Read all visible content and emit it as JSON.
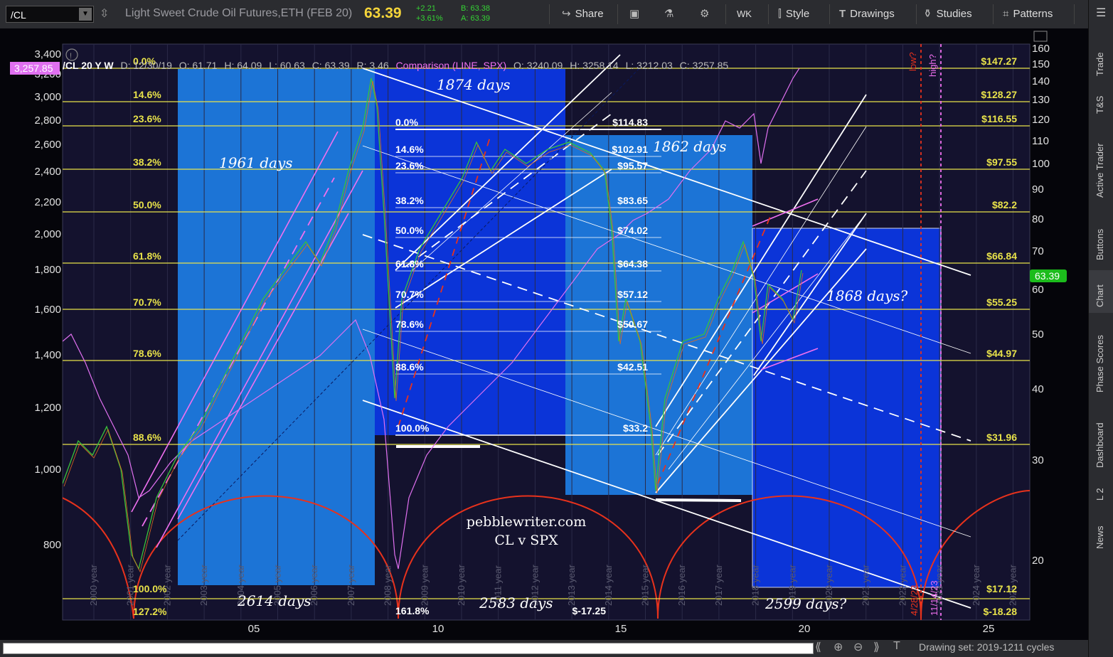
{
  "toolbar": {
    "symbol": "/CL",
    "instrument": "Light Sweet Crude Oil Futures,ETH (FEB 20)",
    "last": "63.39",
    "change": "+2.21",
    "change_pct": "+3.61%",
    "bid": "B: 63.38",
    "ask": "A: 63.39",
    "share": "Share",
    "wk": "WK",
    "style": "Style",
    "drawings": "Drawings",
    "studies": "Studies",
    "patterns": "Patterns"
  },
  "header": {
    "chart_id": "/CL 20 Y W",
    "d": "D: 12/30/19",
    "o": "O: 61.71",
    "h": "H: 64.09",
    "l": "L: 60.63",
    "c": "C: 63.39",
    "r": "R: 3.46",
    "comp": "Comparison (LINE, SPX)",
    "co": "O: 3240.09",
    "ch": "H: 3258.14",
    "cl": "L: 3212.03",
    "cc": "C: 3257.85"
  },
  "left_axis": [
    "3,400",
    "3,200",
    "3,000",
    "2,800",
    "2,600",
    "2,400",
    "2,200",
    "2,000",
    "1,800",
    "1,600",
    "1,400",
    "1,200",
    "1,000",
    "800"
  ],
  "spx_tag": "3,257.85",
  "right_axis": [
    "160",
    "150",
    "140",
    "130",
    "120",
    "110",
    "100",
    "90",
    "80",
    "70",
    "60",
    "50",
    "40",
    "30",
    "20"
  ],
  "price_tag": "63.39",
  "x_axis": [
    "05",
    "10",
    "15",
    "20",
    "25"
  ],
  "year_labels": [
    "2000 year",
    "2001 year",
    "2002 year",
    "2003 year",
    "2004 year",
    "2005 year",
    "2006 year",
    "2007 year",
    "2008 year",
    "2009 year",
    "2010 year",
    "2011 year",
    "2012 year",
    "2013 year",
    "2014 year",
    "2015 year",
    "2016 year",
    "2017 year",
    "2018 year",
    "2019 year",
    "2020 year",
    "2021 year",
    "2022 year",
    "2023 year",
    "2024 year",
    "2025 year"
  ],
  "fib_big": [
    {
      "pct": "0.0%",
      "price": "$147.27"
    },
    {
      "pct": "14.6%",
      "price": "$128.27"
    },
    {
      "pct": "23.6%",
      "price": "$116.55"
    },
    {
      "pct": "38.2%",
      "price": "$97.55"
    },
    {
      "pct": "50.0%",
      "price": "$82.2"
    },
    {
      "pct": "61.8%",
      "price": "$66.84"
    },
    {
      "pct": "70.7%",
      "price": "$55.25"
    },
    {
      "pct": "78.6%",
      "price": "$44.97"
    },
    {
      "pct": "88.6%",
      "price": "$31.96"
    },
    {
      "pct": "100.0%",
      "price": "$17.12"
    },
    {
      "pct": "127.2%",
      "price": "$-18.28"
    }
  ],
  "fib_small": [
    {
      "pct": "0.0%",
      "price": "$114.83"
    },
    {
      "pct": "14.6%",
      "price": "$102.91"
    },
    {
      "pct": "23.6%",
      "price": "$95.57"
    },
    {
      "pct": "38.2%",
      "price": "$83.65"
    },
    {
      "pct": "50.0%",
      "price": "$74.02"
    },
    {
      "pct": "61.8%",
      "price": "$64.38"
    },
    {
      "pct": "70.7%",
      "price": "$57.12"
    },
    {
      "pct": "78.6%",
      "price": "$50.67"
    },
    {
      "pct": "88.6%",
      "price": "$42.51"
    },
    {
      "pct": "100.0%",
      "price": "$33.2"
    },
    {
      "pct": "161.8%",
      "price": "$-17.25"
    }
  ],
  "annotations": {
    "d1961": "1961 days",
    "d1874": "1874 days",
    "d1862": "1862 days",
    "d1868": "1868 days?",
    "d2614": "2614 days",
    "d2583": "2583 days",
    "d2599": "2599 days?",
    "site": "pebblewriter.com",
    "sub": "CL v SPX",
    "low": "low?",
    "high": "high?",
    "date_low": "4/28/23",
    "date_high": "11/14/23"
  },
  "right_rail": [
    "Trade",
    "T&S",
    "Active Trader",
    "Buttons",
    "Chart",
    "Phase Scores",
    "Dashboard",
    "L 2",
    "News"
  ],
  "bottom": {
    "drawing_set": "Drawing set: 2019-1211 cycles"
  },
  "colors": {
    "fib_yellow": "#e8e24a",
    "box_light": "#1c74d6",
    "box_dark": "#0b34d8",
    "spx_pink": "#e070f0",
    "price_green": "#2fbf2f",
    "cycle_red": "#e8321c",
    "text_white": "#ffffff"
  }
}
